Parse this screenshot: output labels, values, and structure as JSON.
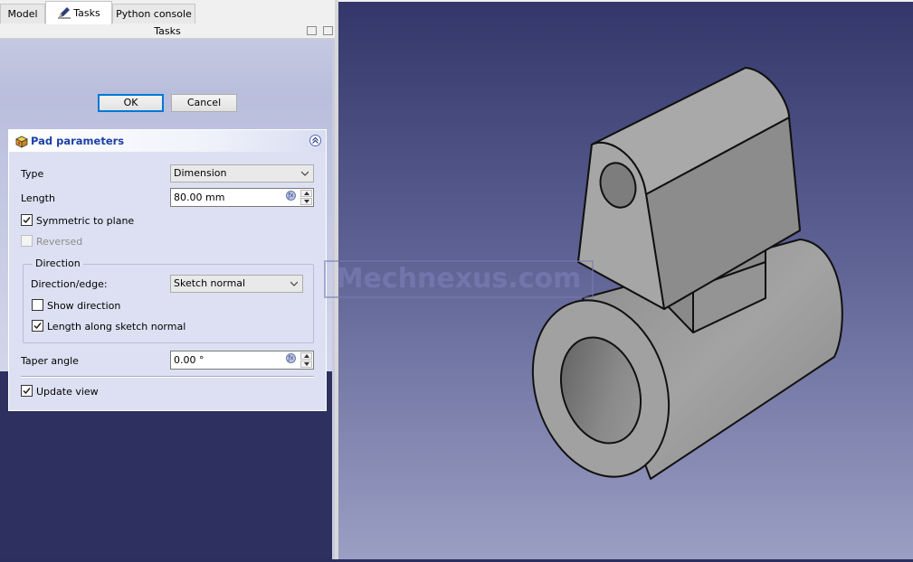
{
  "tabs": [
    {
      "label": "Model"
    },
    {
      "label": "Tasks"
    },
    {
      "label": "Python console"
    }
  ],
  "panel_title": "Tasks",
  "buttons": {
    "ok": "OK",
    "cancel": "Cancel"
  },
  "pad": {
    "title": "Pad parameters",
    "type_label": "Type",
    "type_value": "Dimension",
    "length_label": "Length",
    "length_value": "80.00 mm",
    "symmetric_label": "Symmetric to plane",
    "symmetric_checked": true,
    "reversed_label": "Reversed",
    "reversed_checked": false,
    "direction_group": "Direction",
    "direction_edge_label": "Direction/edge:",
    "direction_edge_value": "Sketch normal",
    "show_direction_label": "Show direction",
    "show_direction_checked": false,
    "along_normal_label": "Length along sketch normal",
    "along_normal_checked": true,
    "taper_label": "Taper angle",
    "taper_value": "0.00 °",
    "update_view_label": "Update view",
    "update_view_checked": true
  },
  "watermark": "Mechnexus.com",
  "colors": {
    "panel_bg": "#2d2f5f",
    "pad_box_bg": "#dde0f2",
    "title_blue": "#1c3fa6",
    "model_face": "#9a9a9a"
  }
}
